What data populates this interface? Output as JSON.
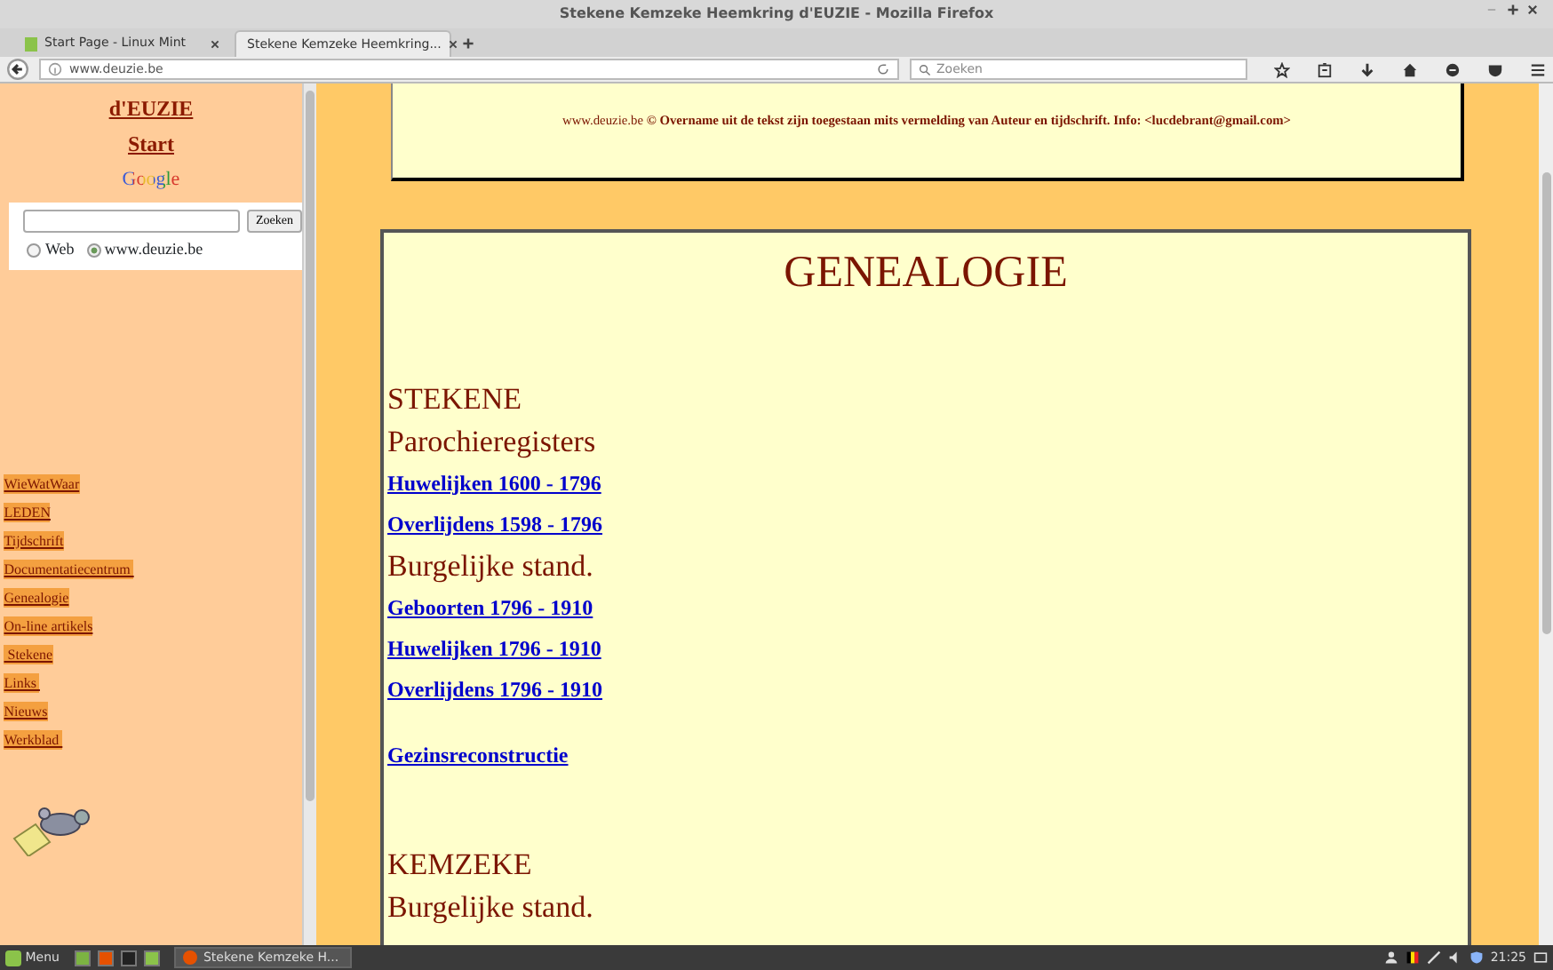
{
  "window": {
    "title": "Stekene Kemzeke Heemkring d'EUZIE - Mozilla Firefox"
  },
  "tabs": [
    {
      "label": "Start Page - Linux Mint",
      "selected": false
    },
    {
      "label": "Stekene Kemzeke Heemkring...",
      "selected": true
    }
  ],
  "toolbar": {
    "url": "www.deuzie.be",
    "search_placeholder": "Zoeken"
  },
  "sidebar": {
    "title": "d'EUZIE",
    "start": "Start",
    "google_logo": "Google",
    "search_button": "Zoeken",
    "radios": [
      {
        "label": "Web",
        "selected": false
      },
      {
        "label": "www.deuzie.be",
        "selected": true
      }
    ],
    "items": [
      "WieWatWaar",
      "LEDEN",
      "Tijdschrift",
      "Documentatiecentrum ",
      "Genealogie",
      "On-line artikels",
      " Stekene",
      "Links ",
      "Nieuws",
      "Werkblad "
    ]
  },
  "notice": {
    "link": "www.deuzie.be",
    "text": "© Overname uit de tekst zijn toegestaan mits vermelding van Auteur en tijdschrift. Info: <lucdebrant@gmail.com>"
  },
  "genealogy": {
    "title": "GENEALOGIE",
    "groups": [
      [
        {
          "kind": "heading",
          "text": "STEKENE"
        },
        {
          "kind": "heading",
          "text": "Parochieregisters"
        },
        {
          "kind": "link",
          "text": "Huwelijken 1600 - 1796"
        },
        {
          "kind": "link",
          "text": "Overlijdens 1598 - 1796"
        },
        {
          "kind": "heading",
          "text": "Burgelijke stand."
        },
        {
          "kind": "link",
          "text": "Geboorten 1796 - 1910"
        },
        {
          "kind": "link",
          "text": "Huwelijken 1796 - 1910"
        },
        {
          "kind": "link",
          "text": "Overlijdens 1796 - 1910"
        }
      ],
      [
        {
          "kind": "link",
          "text": "Gezinsreconstructie"
        }
      ],
      [
        {
          "kind": "heading",
          "text": "KEMZEKE"
        },
        {
          "kind": "heading",
          "text": "Burgelijke stand."
        }
      ]
    ]
  },
  "taskbar": {
    "menu": "Menu",
    "window": "Stekene Kemzeke H...",
    "clock": "21:25"
  }
}
